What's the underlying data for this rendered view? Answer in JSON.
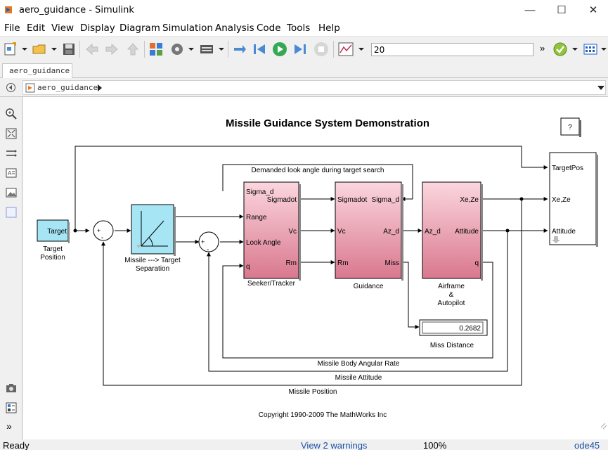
{
  "window": {
    "title": "aero_guidance - Simulink",
    "minimize": "—",
    "maximize": "☐",
    "close": "✕"
  },
  "menu": [
    "File",
    "Edit",
    "View",
    "Display",
    "Diagram",
    "Simulation",
    "Analysis",
    "Code",
    "Tools",
    "Help"
  ],
  "toolbar": {
    "stop_time": "20",
    "icons": [
      "new-model-icon",
      "open-icon",
      "save-icon",
      "back-icon",
      "forward-icon",
      "up-icon",
      "library-browser-icon",
      "model-config-icon",
      "model-explorer-icon",
      "step-back-icon",
      "run-icon",
      "step-forward-icon",
      "stop-icon",
      "scope-icon",
      "more-icon",
      "model-advisor-icon",
      "build-icon"
    ]
  },
  "tab": {
    "label": "aero_guidance"
  },
  "breadcrumb": {
    "model": "aero_guidance"
  },
  "diagram": {
    "title": "Missile Guidance System Demonstration",
    "help_button": "?",
    "copyright": "Copyright 1990-2009 The MathWorks Inc",
    "blocks": {
      "target": {
        "port": "Target",
        "label": "Target\nPosition"
      },
      "separation": {
        "label": "Missile ---> Target\nSeparation"
      },
      "sum1": {
        "plus": "+",
        "minus": "-"
      },
      "sum2": {
        "plus": "+",
        "minus": "-"
      },
      "seeker": {
        "label": "Seeker/Tracker",
        "inputs": [
          "Sigma_d",
          "Range",
          "Look Angle",
          "q"
        ],
        "outputs": [
          "Sigmadot",
          "Vc",
          "Rm"
        ]
      },
      "guidance": {
        "label": "Guidance",
        "inputs": [
          "Sigmadot",
          "Vc",
          "Rm"
        ],
        "outputs": [
          "Sigma_d",
          "Az_d",
          "Miss"
        ]
      },
      "airframe": {
        "label": "Airframe\n&\nAutopilot",
        "inputs": [
          "Az_d"
        ],
        "outputs": [
          "Xe,Ze",
          "Attitude",
          "q"
        ]
      },
      "scope": {
        "inputs": [
          "TargetPos",
          "Xe,Ze",
          "Attitude"
        ]
      },
      "miss_display": {
        "value": "0.2682",
        "label": "Miss Distance"
      }
    },
    "signals": {
      "look_angle": "Demanded look angle during target search",
      "body_rate": "Missile Body Angular Rate",
      "attitude": "Missile Attitude",
      "position": "Missile Position"
    }
  },
  "status": {
    "state": "Ready",
    "warnings": "View 2 warnings",
    "zoom": "100%",
    "solver": "ode45"
  },
  "colors": {
    "accent_pink": "#f7c6d0",
    "cyan_block": "#a6e6f4",
    "link_blue": "#1a4fa8"
  }
}
